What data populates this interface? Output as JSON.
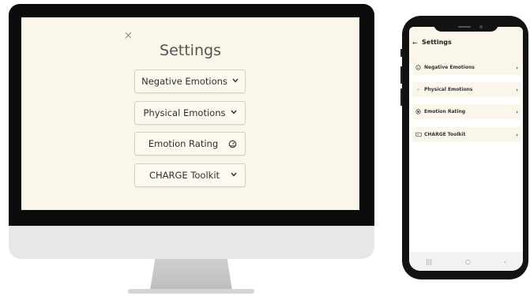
{
  "desktop": {
    "close_label": "×",
    "title": "Settings",
    "buttons": [
      {
        "label": "Negative Emotions",
        "icon": "chevron-down-icon"
      },
      {
        "label": "Physical Emotions",
        "icon": "chevron-down-icon"
      },
      {
        "label": "Emotion Rating",
        "icon": "gauge-icon"
      },
      {
        "label": "CHARGE Toolkit",
        "icon": "chevron-down-icon"
      }
    ]
  },
  "mobile": {
    "back_label": "←",
    "title": "Settings",
    "items": [
      {
        "label": "Negative Emotions",
        "icon": "emoji-icon",
        "chevron": "›"
      },
      {
        "label": "Physical Emotions",
        "icon": "spark-icon",
        "chevron": "›"
      },
      {
        "label": "Emotion Rating",
        "icon": "radio-icon",
        "chevron": "›"
      },
      {
        "label": "CHARGE Toolkit",
        "icon": "toolkit-icon",
        "chevron": "›"
      }
    ],
    "nav": [
      "|||",
      "○",
      "‹"
    ]
  },
  "colors": {
    "screen_bg": "#fbf6ea",
    "bezel": "#0b0b0b",
    "text": "#2f2f2f"
  }
}
